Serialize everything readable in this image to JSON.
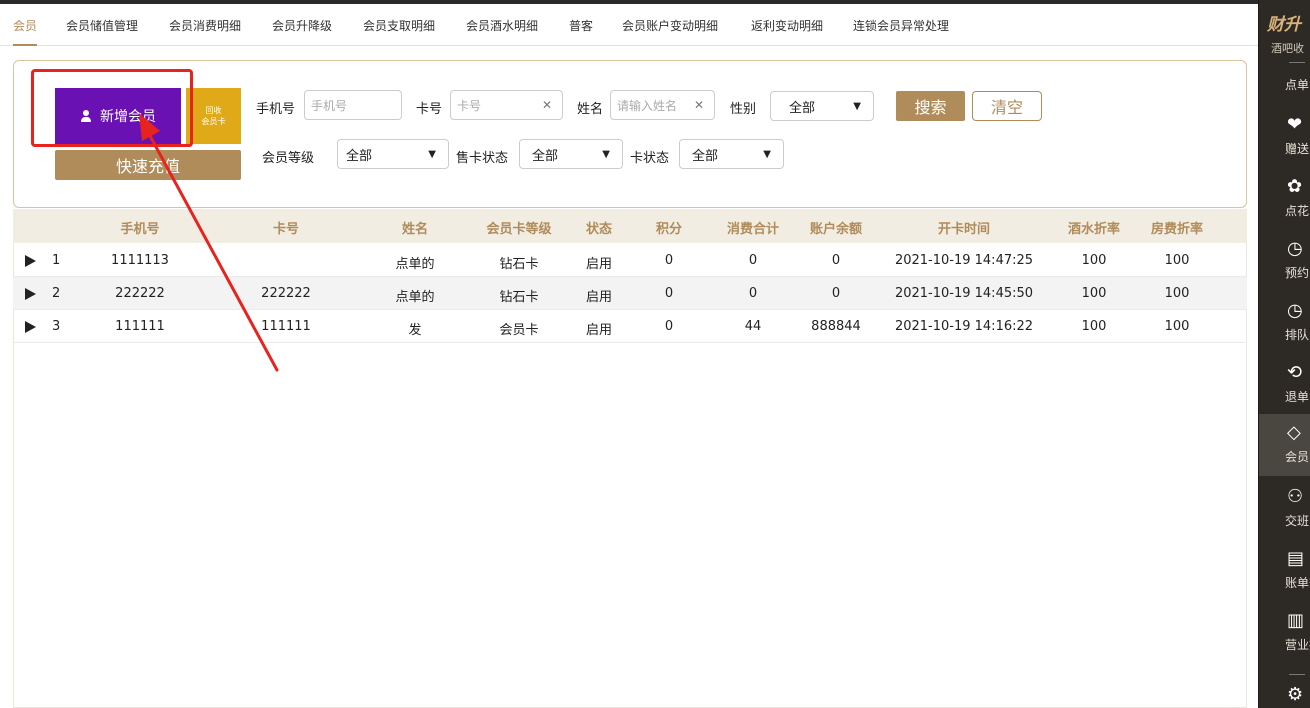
{
  "tabs": [
    "会员",
    "会员储值管理",
    "会员消费明细",
    "会员升降级",
    "会员支取明细",
    "会员酒水明细",
    "普客",
    "会员账户变动明细",
    "返利变动明细",
    "连锁会员异常处理"
  ],
  "actions": {
    "new_member": "新增会员",
    "recycle_line1": "回收",
    "recycle_line2": "会员卡",
    "quick_recharge": "快速充值"
  },
  "filters": {
    "phone_label": "手机号",
    "phone_placeholder": "手机号",
    "card_label": "卡号",
    "card_placeholder": "卡号",
    "name_label": "姓名",
    "name_placeholder": "请输入姓名",
    "gender_label": "性别",
    "gender_value": "全部",
    "level_label": "会员等级",
    "level_value": "全部",
    "sale_status_label": "售卡状态",
    "sale_status_value": "全部",
    "card_status_label": "卡状态",
    "card_status_value": "全部",
    "search_button": "搜索",
    "clear_button": "清空"
  },
  "table": {
    "headers": [
      "手机号",
      "卡号",
      "姓名",
      "会员卡等级",
      "状态",
      "积分",
      "消费合计",
      "账户余额",
      "开卡时间",
      "酒水折率",
      "房费折率"
    ],
    "rows": [
      {
        "index": "1",
        "phone": "1111113",
        "card": "",
        "name": "点单的",
        "level": "钻石卡",
        "status": "启用",
        "points": "0",
        "consumption": "0",
        "balance": "0",
        "open_time": "2021-10-19 14:47:25",
        "drink_rate": "100",
        "room_rate": "100"
      },
      {
        "index": "2",
        "phone": "222222",
        "card": "222222",
        "name": "点单的",
        "level": "钻石卡",
        "status": "启用",
        "points": "0",
        "consumption": "0",
        "balance": "0",
        "open_time": "2021-10-19 14:45:50",
        "drink_rate": "100",
        "room_rate": "100"
      },
      {
        "index": "3",
        "phone": "111111",
        "card": "111111",
        "name": "发",
        "level": "会员卡",
        "status": "启用",
        "points": "0",
        "consumption": "44",
        "balance": "888844",
        "open_time": "2021-10-19 14:16:22",
        "drink_rate": "100",
        "room_rate": "100"
      }
    ]
  },
  "sidebar": {
    "brand": "财升",
    "subtitle": "酒吧收",
    "items": [
      {
        "label": "点单",
        "icon": "order-icon"
      },
      {
        "label": "赠送",
        "icon": "gift-icon"
      },
      {
        "label": "点花",
        "icon": "flower-icon"
      },
      {
        "label": "预约",
        "icon": "clock-icon"
      },
      {
        "label": "排队",
        "icon": "queue-clock-icon"
      },
      {
        "label": "退单",
        "icon": "refund-icon"
      },
      {
        "label": "会员",
        "icon": "diamond-icon"
      },
      {
        "label": "交班",
        "icon": "handover-icon"
      },
      {
        "label": "账单查",
        "icon": "bill-icon"
      },
      {
        "label": "营业报",
        "icon": "report-icon"
      }
    ]
  },
  "colors": {
    "accent": "#b08c5a",
    "new_member_bg": "#6a11b3",
    "recycle_bg": "#e0a918",
    "annotation_red": "#e8231e",
    "sidebar_bg": "#2d2a26"
  }
}
